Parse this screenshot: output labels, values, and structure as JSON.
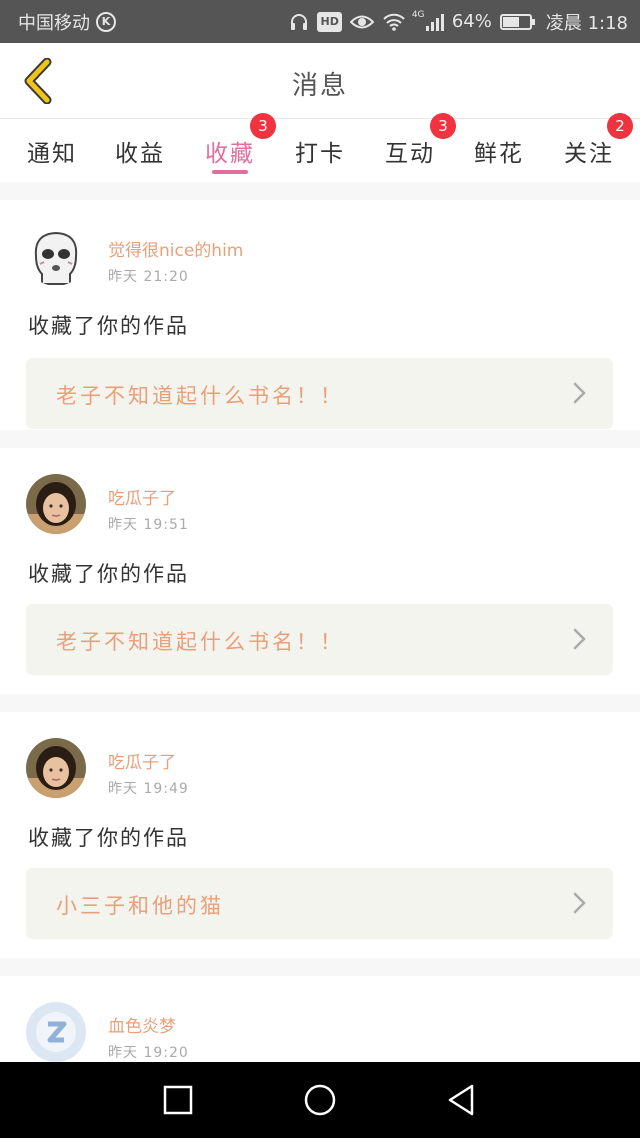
{
  "status_bar": {
    "carrier": "中国移动",
    "carrier_badge": "K",
    "hd": "HD",
    "network": "4G",
    "battery_percent": "64%",
    "battery_level": 0.64,
    "time": "凌晨 1:18"
  },
  "header": {
    "title": "消息",
    "back_icon": "chevron-left-icon",
    "back_icon_color": "#f0c419"
  },
  "tabs": [
    {
      "label": "通知"
    },
    {
      "label": "收益"
    },
    {
      "label": "收藏",
      "badge": "3",
      "active": true
    },
    {
      "label": "打卡"
    },
    {
      "label": "互动",
      "badge": "3"
    },
    {
      "label": "鲜花"
    },
    {
      "label": "关注",
      "badge": "2"
    }
  ],
  "accent_color": "#e06fa0",
  "badge_color": "#f0333f",
  "username_color": "#e8a07a",
  "notifications": [
    {
      "username": "觉得很nice的him",
      "time": "昨天 21:20",
      "action": "收藏了你的作品",
      "work_title": "老子不知道起什么书名！！",
      "avatar": "sticker-face-avatar"
    },
    {
      "username": "吃瓜子了",
      "time": "昨天 19:51",
      "action": "收藏了你的作品",
      "work_title": "老子不知道起什么书名！！",
      "avatar": "girl-photo-avatar"
    },
    {
      "username": "吃瓜子了",
      "time": "昨天 19:49",
      "action": "收藏了你的作品",
      "work_title": "小三子和他的猫",
      "avatar": "girl-photo-avatar"
    },
    {
      "username": "血色炎梦",
      "time": "昨天 19:20",
      "action": "",
      "work_title": "",
      "avatar": "qq-default-avatar"
    }
  ],
  "nav_bar": {
    "recent_icon": "square-icon",
    "home_icon": "circle-icon",
    "back_icon": "triangle-back-icon"
  }
}
